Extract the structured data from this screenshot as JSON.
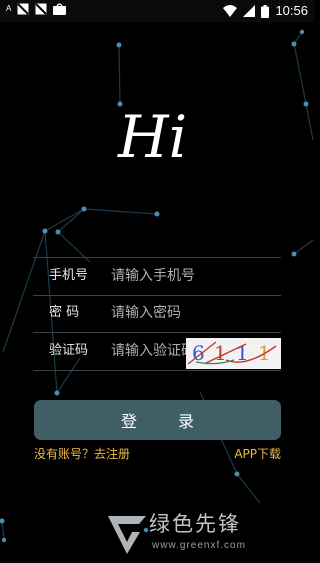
{
  "status_bar": {
    "time": "10:56",
    "indicator_text": "A"
  },
  "greeting": "Hi",
  "form": {
    "phone": {
      "label": "手机号",
      "placeholder": "请输入手机号"
    },
    "password": {
      "label": "密 码",
      "placeholder": "请输入密码"
    },
    "captcha": {
      "label": "验证码",
      "placeholder": "请输入验证码",
      "image_text": "6111"
    }
  },
  "login_button": "登 录",
  "register_link": "没有账号？去注册",
  "download_link": "APP下载",
  "watermark": {
    "brand": "绿色先锋",
    "url": "www.greenxf.com"
  },
  "colors": {
    "background": "#000000",
    "button": "#3f5e66",
    "link": "#f0b94a"
  }
}
